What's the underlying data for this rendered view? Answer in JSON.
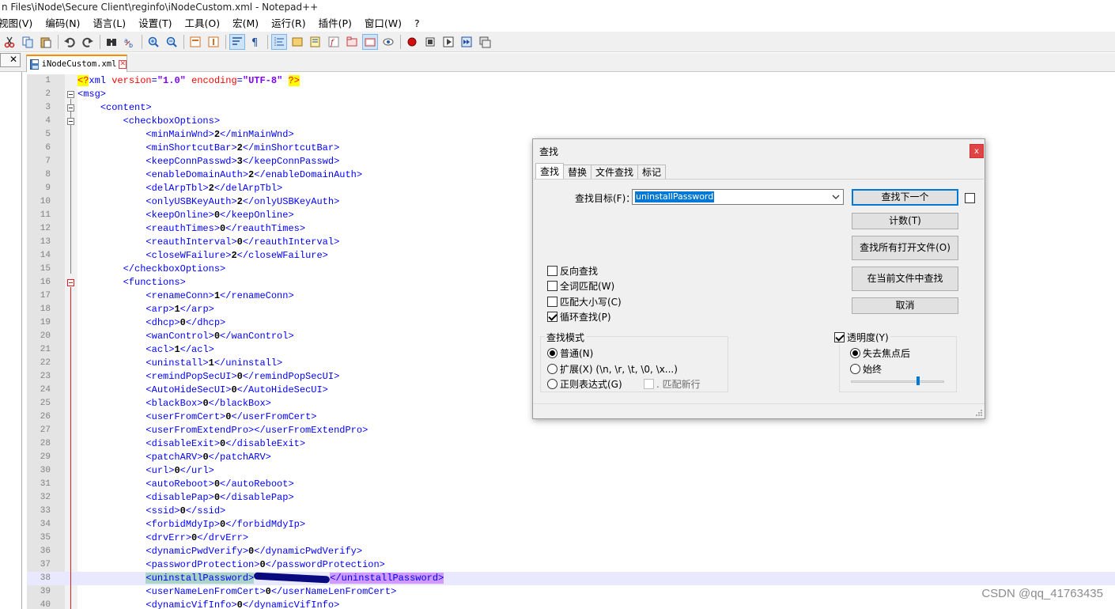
{
  "window": {
    "title": "n Files\\iNode\\Secure Client\\reginfo\\iNodeCustom.xml - Notepad++"
  },
  "menu": [
    "视图(V)",
    "编码(N)",
    "语言(L)",
    "设置(T)",
    "工具(O)",
    "宏(M)",
    "运行(R)",
    "插件(P)",
    "窗口(W)",
    "?"
  ],
  "left_panel": {
    "close_label": "✕"
  },
  "tab": {
    "label": "iNodeCustom.xml",
    "close_label": "✕"
  },
  "editor": {
    "current_line": 38,
    "lines": [
      {
        "n": "1",
        "text": ""
      },
      {
        "n": "2",
        "text": ""
      },
      {
        "n": "3",
        "text": ""
      },
      {
        "n": "4",
        "text": ""
      },
      {
        "n": "5",
        "text": ""
      },
      {
        "n": "6",
        "text": ""
      },
      {
        "n": "7",
        "text": ""
      },
      {
        "n": "8",
        "text": ""
      },
      {
        "n": "9",
        "text": ""
      },
      {
        "n": "10",
        "text": ""
      },
      {
        "n": "11",
        "text": ""
      },
      {
        "n": "12",
        "text": ""
      },
      {
        "n": "13",
        "text": ""
      },
      {
        "n": "14",
        "text": ""
      },
      {
        "n": "15",
        "text": ""
      },
      {
        "n": "16",
        "text": ""
      },
      {
        "n": "17",
        "text": ""
      },
      {
        "n": "18",
        "text": ""
      },
      {
        "n": "19",
        "text": ""
      },
      {
        "n": "20",
        "text": ""
      },
      {
        "n": "21",
        "text": ""
      },
      {
        "n": "22",
        "text": ""
      },
      {
        "n": "23",
        "text": ""
      },
      {
        "n": "24",
        "text": ""
      },
      {
        "n": "25",
        "text": ""
      },
      {
        "n": "26",
        "text": ""
      },
      {
        "n": "27",
        "text": ""
      },
      {
        "n": "28",
        "text": ""
      },
      {
        "n": "29",
        "text": ""
      },
      {
        "n": "30",
        "text": ""
      },
      {
        "n": "31",
        "text": ""
      },
      {
        "n": "32",
        "text": ""
      },
      {
        "n": "33",
        "text": ""
      },
      {
        "n": "34",
        "text": ""
      },
      {
        "n": "35",
        "text": ""
      },
      {
        "n": "36",
        "text": ""
      },
      {
        "n": "37",
        "text": ""
      },
      {
        "n": "38",
        "text": ""
      },
      {
        "n": "39",
        "text": ""
      },
      {
        "n": "40",
        "text": ""
      }
    ],
    "xml_decl": {
      "open": "<?",
      "name": "xml",
      "version_attr": "version",
      "version_val": "\"1.0\"",
      "encoding_attr": "encoding",
      "encoding_val": "\"UTF-8\"",
      "close": "?>"
    },
    "elements": [
      {
        "tag": "minMainWnd",
        "val": "2"
      },
      {
        "tag": "minShortcutBar",
        "val": "2"
      },
      {
        "tag": "keepConnPasswd",
        "val": "3"
      },
      {
        "tag": "enableDomainAuth",
        "val": "2"
      },
      {
        "tag": "delArpTbl",
        "val": "2"
      },
      {
        "tag": "onlyUSBKeyAuth",
        "val": "2"
      },
      {
        "tag": "keepOnline",
        "val": "0"
      },
      {
        "tag": "reauthTimes",
        "val": "0"
      },
      {
        "tag": "reauthInterval",
        "val": "0"
      },
      {
        "tag": "closeWFailure",
        "val": "2"
      },
      {
        "tag": "renameConn",
        "val": "1"
      },
      {
        "tag": "arp",
        "val": "1"
      },
      {
        "tag": "dhcp",
        "val": "0"
      },
      {
        "tag": "wanControl",
        "val": "0"
      },
      {
        "tag": "acl",
        "val": "1"
      },
      {
        "tag": "uninstall",
        "val": "1"
      },
      {
        "tag": "remindPopSecUI",
        "val": "0"
      },
      {
        "tag": "AutoHideSecUI",
        "val": "0"
      },
      {
        "tag": "blackBox",
        "val": "0"
      },
      {
        "tag": "userFromCert",
        "val": "0"
      },
      {
        "tag": "userFromExtendPro",
        "val": ""
      },
      {
        "tag": "disableExit",
        "val": "0"
      },
      {
        "tag": "patchARV",
        "val": "0"
      },
      {
        "tag": "url",
        "val": "0"
      },
      {
        "tag": "autoReboot",
        "val": "0"
      },
      {
        "tag": "disablePap",
        "val": "0"
      },
      {
        "tag": "ssid",
        "val": "0"
      },
      {
        "tag": "forbidMdyIp",
        "val": "0"
      },
      {
        "tag": "drvErr",
        "val": "0"
      },
      {
        "tag": "dynamicPwdVerify",
        "val": "0"
      },
      {
        "tag": "passwordProtection",
        "val": "0"
      },
      {
        "tag": "uninstallPassword",
        "val": ""
      },
      {
        "tag": "userNameLenFromCert",
        "val": "0"
      },
      {
        "tag": "dynamicVifInfo",
        "val": "0"
      }
    ],
    "containers": {
      "root": "msg",
      "content": "content",
      "checkbox_options": "checkboxOptions",
      "functions": "functions"
    }
  },
  "find_dialog": {
    "title": "查找",
    "close_label": "x",
    "tabs": [
      "查找",
      "替换",
      "文件查找",
      "标记"
    ],
    "find_label": "查找目标(F)：",
    "find_value": "uninstallPassword",
    "buttons": {
      "find_next": "查找下一个",
      "count": "计数(T)",
      "find_all_open": "查找所有打开文件(O)",
      "find_in_current": "在当前文件中查找",
      "cancel": "取消"
    },
    "options": {
      "backward": {
        "label": "反向查找",
        "checked": false
      },
      "whole_word": {
        "label": "全词匹配(W)",
        "checked": false
      },
      "match_case": {
        "label": "匹配大小写(C)",
        "checked": false
      },
      "wrap_around": {
        "label": "循环查找(P)",
        "checked": true
      }
    },
    "search_mode": {
      "title": "查找模式",
      "normal": "普通(N)",
      "extended": "扩展(X) (\\n, \\r, \\t, \\0, \\x...)",
      "regex": "正则表达式(G)",
      "dot_newline": ". 匹配新行",
      "selected": "normal"
    },
    "transparency": {
      "label": "透明度(Y)",
      "checked": true,
      "on_lose_focus": "失去焦点后",
      "always": "始终",
      "selected": "on_lose_focus",
      "level": 0.7
    }
  },
  "watermark": "CSDN @qq_41763435"
}
